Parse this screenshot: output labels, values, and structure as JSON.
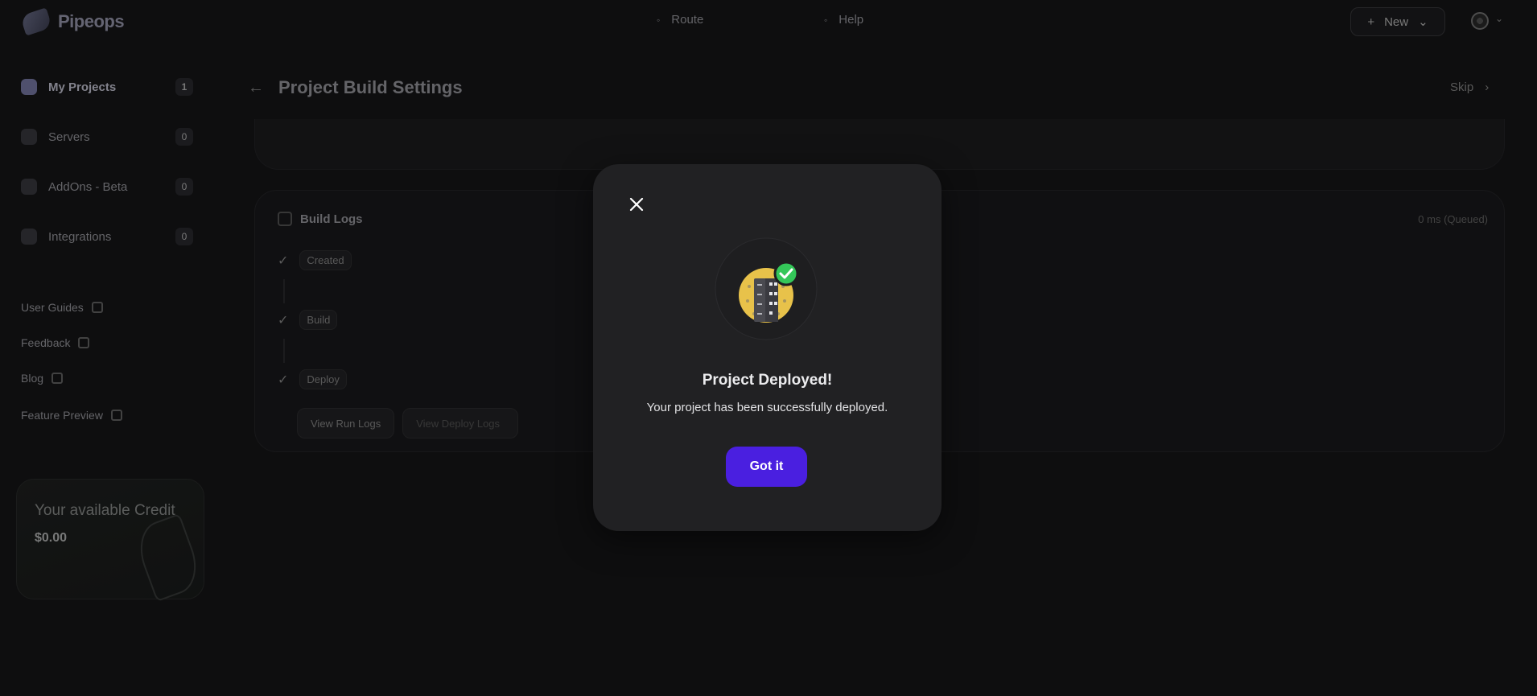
{
  "app": {
    "logo_text": "Pipeops"
  },
  "topbar": {
    "nav": [
      {
        "label": "Route"
      },
      {
        "label": "Help"
      }
    ],
    "new_button": "New"
  },
  "sidebar": {
    "items": [
      {
        "label": "My Projects",
        "count": "1"
      },
      {
        "label": "Servers",
        "count": "0"
      },
      {
        "label": "AddOns - Beta",
        "count": "0"
      },
      {
        "label": "Integrations",
        "count": "0"
      }
    ],
    "links": [
      {
        "label": "User Guides"
      },
      {
        "label": "Feedback"
      },
      {
        "label": "Blog"
      },
      {
        "label": "Feature Preview"
      }
    ],
    "credit": {
      "title": "Your available Credit",
      "value": "$0.00"
    }
  },
  "main": {
    "title": "Project Build Settings",
    "skip_label": "Skip"
  },
  "logs": {
    "title": "Build Logs",
    "time": "0 ms (Queued)",
    "steps": [
      "Created",
      "Build",
      "Deploy"
    ],
    "buttons": [
      "View Run Logs",
      "View Deploy Logs"
    ]
  },
  "modal": {
    "title": "Project Deployed!",
    "message": "Your project has been successfully deployed.",
    "button_label": "Got it",
    "colors": {
      "button": "#4a1fe0",
      "success": "#34c759",
      "illustration_bg": "#e8c24a"
    }
  }
}
